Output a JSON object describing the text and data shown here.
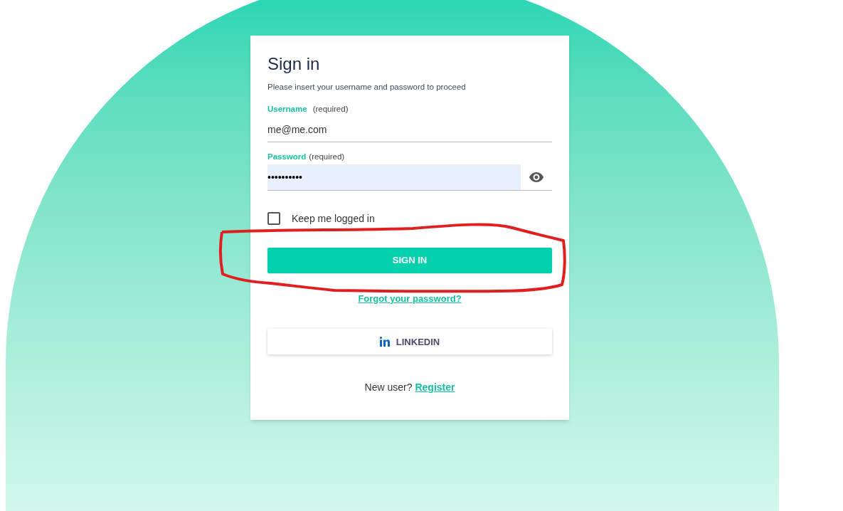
{
  "title": "Sign in",
  "subtitle": "Please insert your username and password to proceed",
  "fields": [
    {
      "kind": "text",
      "label": "Username",
      "hint": "(required)",
      "value": "me@me.com"
    },
    {
      "kind": "password",
      "label": "Password",
      "hint": "(required)",
      "value": "••••••••••"
    }
  ],
  "keep_logged_in": {
    "label": "Keep me logged in",
    "checked": false
  },
  "sign_in_button": "SIGN IN",
  "forgot_link": "Forgot your password?",
  "linkedin_button": "LINKEDIN",
  "register": {
    "prompt": "New user?",
    "link": "Register"
  }
}
